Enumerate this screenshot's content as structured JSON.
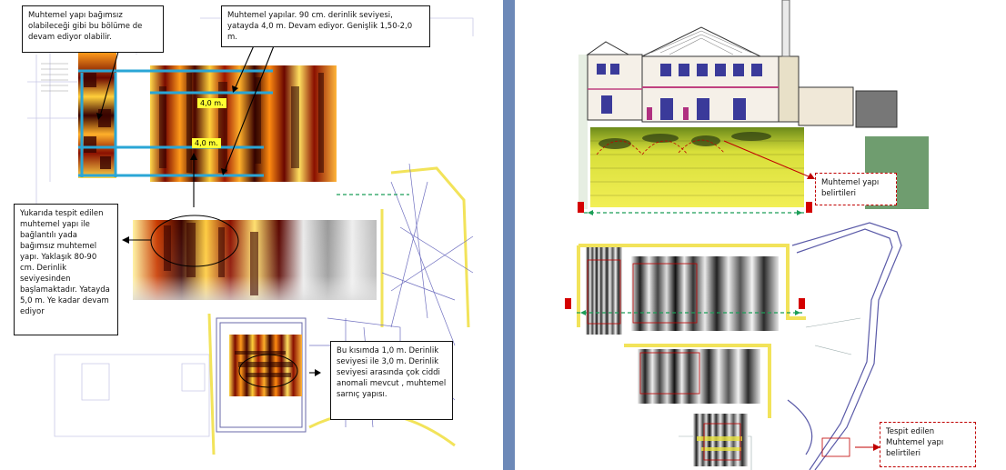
{
  "left_panel": {
    "callouts": {
      "top_left": "Muhtemel yapı bağımsız olabileceği gibi bu bölüme de devam ediyor olabilir.",
      "top_right": "Muhtemel yapılar. 90 cm. derinlik seviyesi, yatayda 4,0 m. Devam ediyor. Genişlik 1,50-2,0 m.",
      "middle_left": "Yukarıda tespit edilen muhtemel yapı ile bağlantılı yada bağımsız muhtemel yapı. Yaklaşık 80-90 cm. Derinlik seviyesinden başlamaktadır. Yatayda 5,0 m. Ye kadar devam ediyor",
      "bottom_right": "Bu kısımda 1,0 m. Derinlik seviyesi ile 3,0 m. Derinlik seviyesi arasında çok ciddi anomali mevcut , muhtemel sarnıç yapısı."
    },
    "tags": [
      "4,0 m.",
      "4,0 m."
    ]
  },
  "right_panel": {
    "callouts": {
      "upper": "Muhtemel yapı belirtileri",
      "lower": "Tespit edilen Muhtemel yapı belirtileri"
    }
  },
  "colors": {
    "divider": "#6d89b8",
    "guide_line": "#2aa6d6",
    "marker_red": "#d40000",
    "green_line": "#1b9e57"
  }
}
